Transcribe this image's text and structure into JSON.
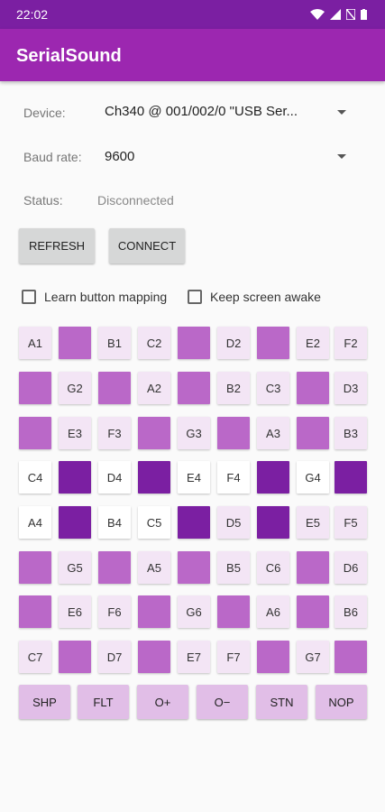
{
  "status_bar": {
    "time": "22:02"
  },
  "app": {
    "title": "SerialSound"
  },
  "form": {
    "device_label": "Device:",
    "device_value": "Ch340 @ 001/002/0 \"USB Ser...",
    "baud_label": "Baud rate:",
    "baud_value": "9600",
    "status_label": "Status:",
    "status_value": "Disconnected"
  },
  "buttons": {
    "refresh": "REFRESH",
    "connect": "CONNECT"
  },
  "options": {
    "learn_label": "Learn button mapping",
    "learn_checked": false,
    "awake_label": "Keep screen awake",
    "awake_checked": false
  },
  "pads": [
    [
      "A1",
      "",
      "B1",
      "C2",
      "",
      "D2",
      "",
      "E2",
      "F2"
    ],
    [
      "",
      "G2",
      "",
      "A2",
      "",
      "B2",
      "C3",
      "",
      "D3"
    ],
    [
      "",
      "E3",
      "F3",
      "",
      "G3",
      "",
      "A3",
      "",
      "B3"
    ],
    [
      "C4",
      "",
      "D4",
      "",
      "E4",
      "F4",
      "",
      "G4",
      ""
    ],
    [
      "A4",
      "",
      "B4",
      "C5",
      "",
      "D5",
      "",
      "E5",
      "F5"
    ],
    [
      "",
      "G5",
      "",
      "A5",
      "",
      "B5",
      "C6",
      "",
      "D6"
    ],
    [
      "",
      "E6",
      "F6",
      "",
      "G6",
      "",
      "A6",
      "",
      "B6"
    ],
    [
      "C7",
      "",
      "D7",
      "",
      "E7",
      "F7",
      "",
      "G7",
      ""
    ]
  ],
  "commands": [
    "SHP",
    "FLT",
    "O+",
    "O−",
    "STN",
    "NOP"
  ],
  "colors": {
    "status_bar": "#7b1fa2",
    "app_bar": "#9c27b0",
    "pad_light": "#f3e5f5",
    "pad_medium": "#ba68c8",
    "pad_dark": "#7b1fa2",
    "command": "#e1bee7"
  }
}
